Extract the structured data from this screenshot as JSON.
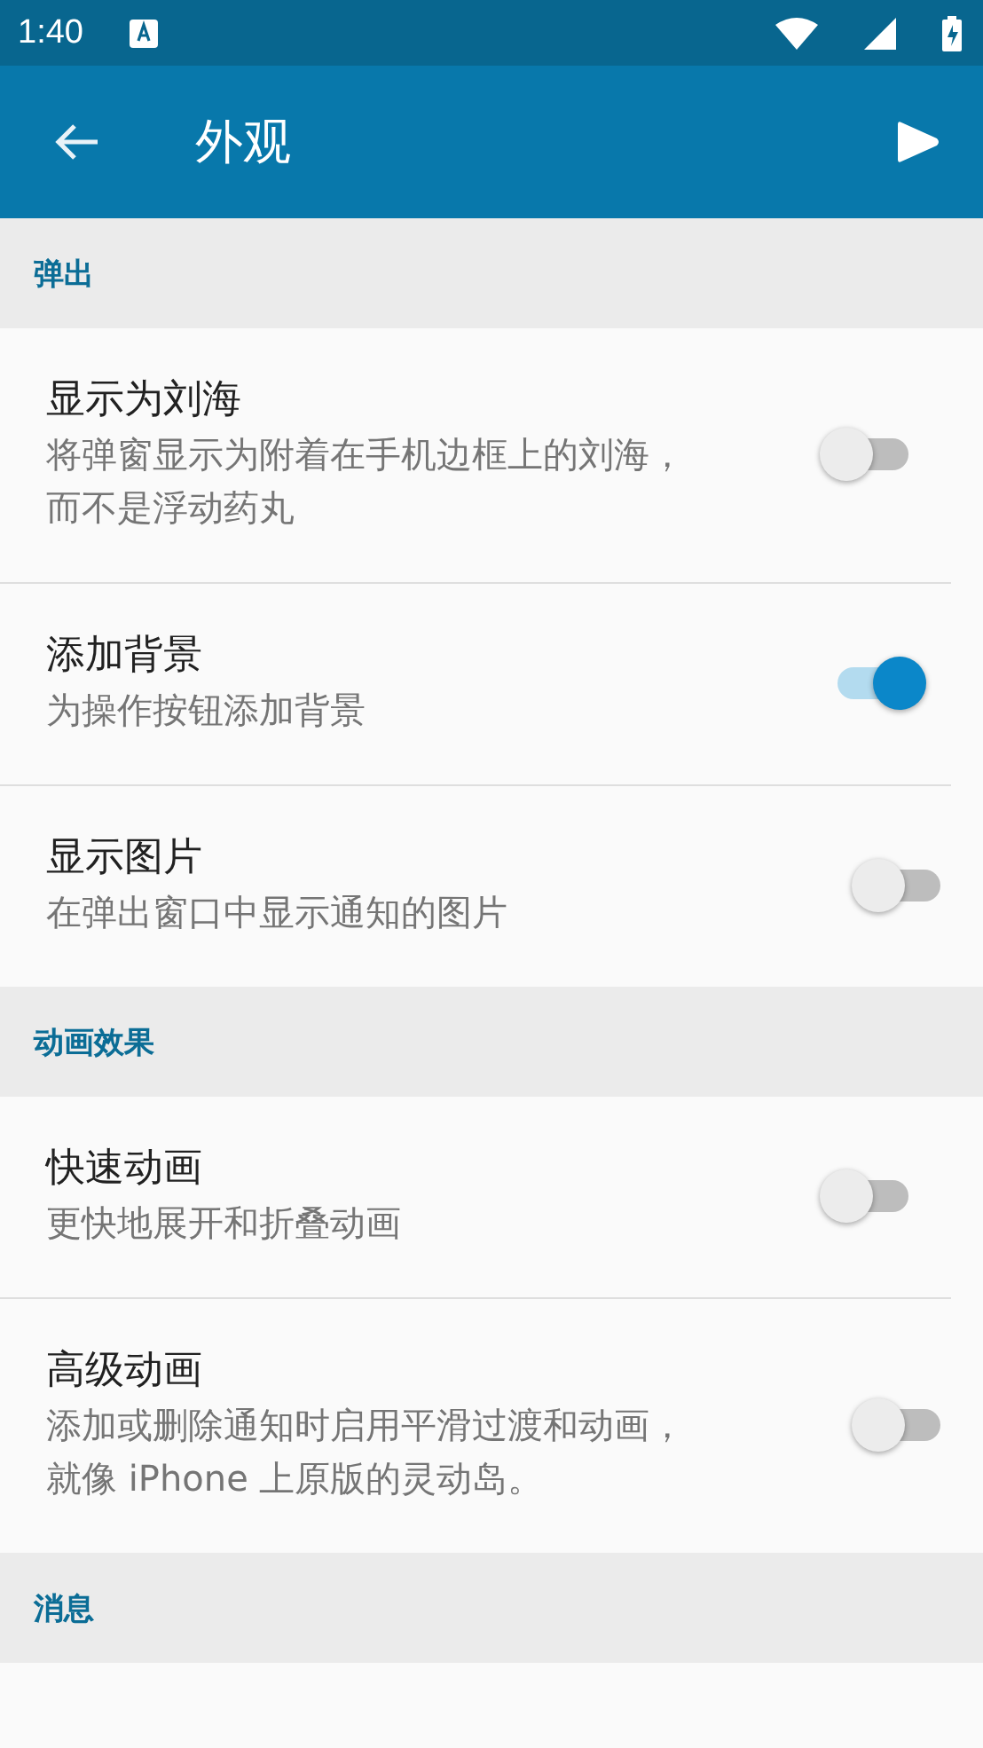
{
  "status_bar": {
    "time": "1:40"
  },
  "app_bar": {
    "title": "外观"
  },
  "sections": [
    {
      "title": "弹出",
      "items": [
        {
          "title": "显示为刘海",
          "subtitle": "将弹窗显示为附着在手机边框上的刘海，而不是浮动药丸",
          "on": false
        },
        {
          "title": "添加背景",
          "subtitle": "为操作按钮添加背景",
          "on": true
        },
        {
          "title": "显示图片",
          "subtitle": "在弹出窗口中显示通知的图片",
          "on": false
        }
      ]
    },
    {
      "title": "动画效果",
      "items": [
        {
          "title": "快速动画",
          "subtitle": "更快地展开和折叠动画",
          "on": false
        },
        {
          "title": "高级动画",
          "subtitle": "添加或删除通知时启用平滑过渡和动画，就像 iPhone 上原版的灵动岛。",
          "on": false
        }
      ]
    },
    {
      "title": "消息"
    }
  ]
}
